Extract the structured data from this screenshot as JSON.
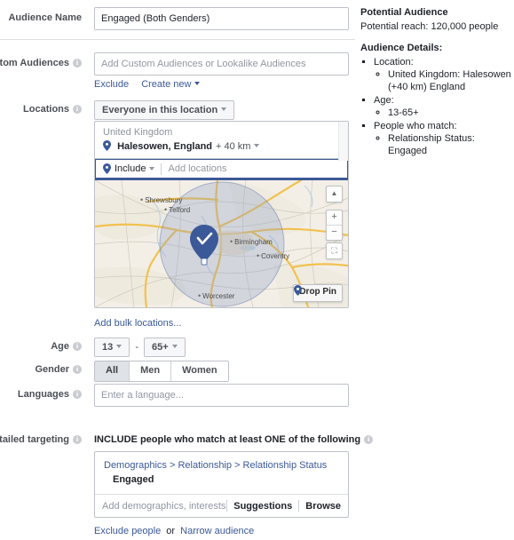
{
  "form": {
    "audience_name": {
      "label": "Audience Name",
      "value": "Engaged (Both Genders)"
    },
    "custom_audiences": {
      "label": "Custom Audiences",
      "placeholder": "Add Custom Audiences or Lookalike Audiences",
      "value": "",
      "exclude_link": "Exclude",
      "create_new_link": "Create new"
    },
    "locations": {
      "label": "Locations",
      "scope_button": "Everyone in this location",
      "country_group": "United Kingdom",
      "entry_name": "Halesowen, England",
      "entry_radius": "+ 40 km",
      "include_label": "Include",
      "add_locations_placeholder": "Add locations",
      "add_locations_value": "",
      "bulk_link": "Add bulk locations...",
      "map": {
        "city_labels": [
          "Shrewsbury",
          "Telford",
          "Birmingham",
          "Coventry",
          "Worcester"
        ],
        "drop_pin_button": "Drop Pin",
        "zoom_in": "+",
        "zoom_out": "−"
      }
    },
    "age": {
      "label": "Age",
      "min": "13",
      "max": "65+",
      "separator": "-"
    },
    "gender": {
      "label": "Gender",
      "options": [
        "All",
        "Men",
        "Women"
      ],
      "selected": "All"
    },
    "languages": {
      "label": "Languages",
      "placeholder": "Enter a language...",
      "value": ""
    },
    "detailed_targeting": {
      "label": "Detailed targeting",
      "heading": "INCLUDE people who match at least ONE of the following",
      "breadcrumb": "Demographics > Relationship > Relationship Status",
      "selected_value": "Engaged",
      "placeholder": "Add demographics, interests or behavio...",
      "input_value": "",
      "suggestions_button": "Suggestions",
      "browse_button": "Browse",
      "exclude_link": "Exclude people",
      "or_text": "or",
      "narrow_link": "Narrow audience"
    }
  },
  "sidebar": {
    "title": "Potential Audience",
    "reach": "Potential reach: 120,000 people",
    "details_title": "Audience Details:",
    "details": [
      {
        "label": "Location:",
        "items": [
          "United Kingdom: Halesowen (+40 km) England"
        ]
      },
      {
        "label": "Age:",
        "items": [
          "13-65+"
        ]
      },
      {
        "label": "People who match:",
        "items": [
          "Relationship Status: Engaged"
        ]
      }
    ]
  },
  "colors": {
    "link": "#3b5998",
    "pin": "#3b5998",
    "map_land": "#f3efe7",
    "map_road": "#f2c14e",
    "radius_fill": "#8d9ec4"
  }
}
